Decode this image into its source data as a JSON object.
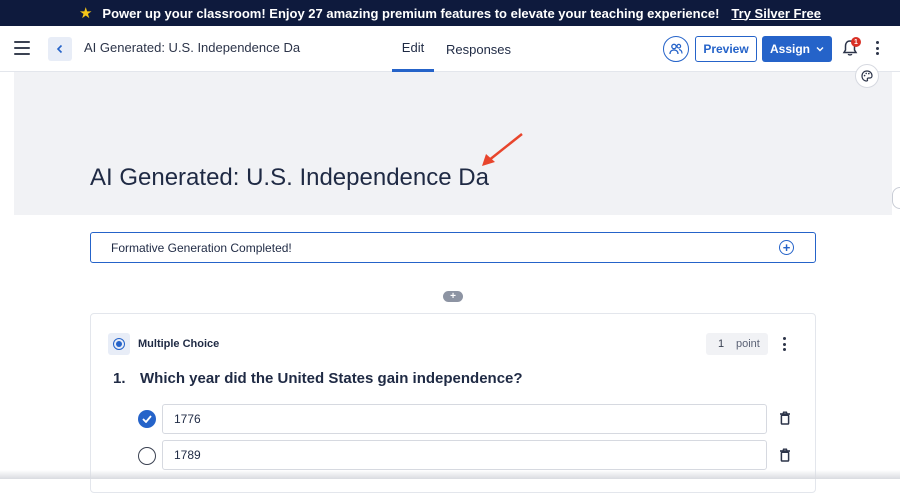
{
  "promo": {
    "message": "Power up your classroom! Enjoy 27 amazing premium features to elevate your teaching experience!",
    "link": "Try Silver Free"
  },
  "header": {
    "title": "AI Generated: U.S. Independence Da",
    "tabs": [
      {
        "label": "Edit",
        "active": true
      },
      {
        "label": "Responses",
        "active": false
      }
    ],
    "preview_label": "Preview",
    "assign_label": "Assign",
    "notification_count": "1"
  },
  "banner": {
    "title": "AI Generated: U.S. Independence Da"
  },
  "status": {
    "message": "Formative Generation Completed!"
  },
  "question": {
    "type_label": "Multiple Choice",
    "points_value": "1",
    "points_unit": "point",
    "number": "1.",
    "text": "Which year did the United States gain independence?",
    "choices": [
      {
        "text": "1776",
        "correct": true
      },
      {
        "text": "1789",
        "correct": false
      }
    ]
  },
  "colors": {
    "accent": "#2563c9",
    "promo_bg": "#0e1a3d",
    "annotation_arrow": "#e8452c",
    "badge": "#d93025"
  }
}
